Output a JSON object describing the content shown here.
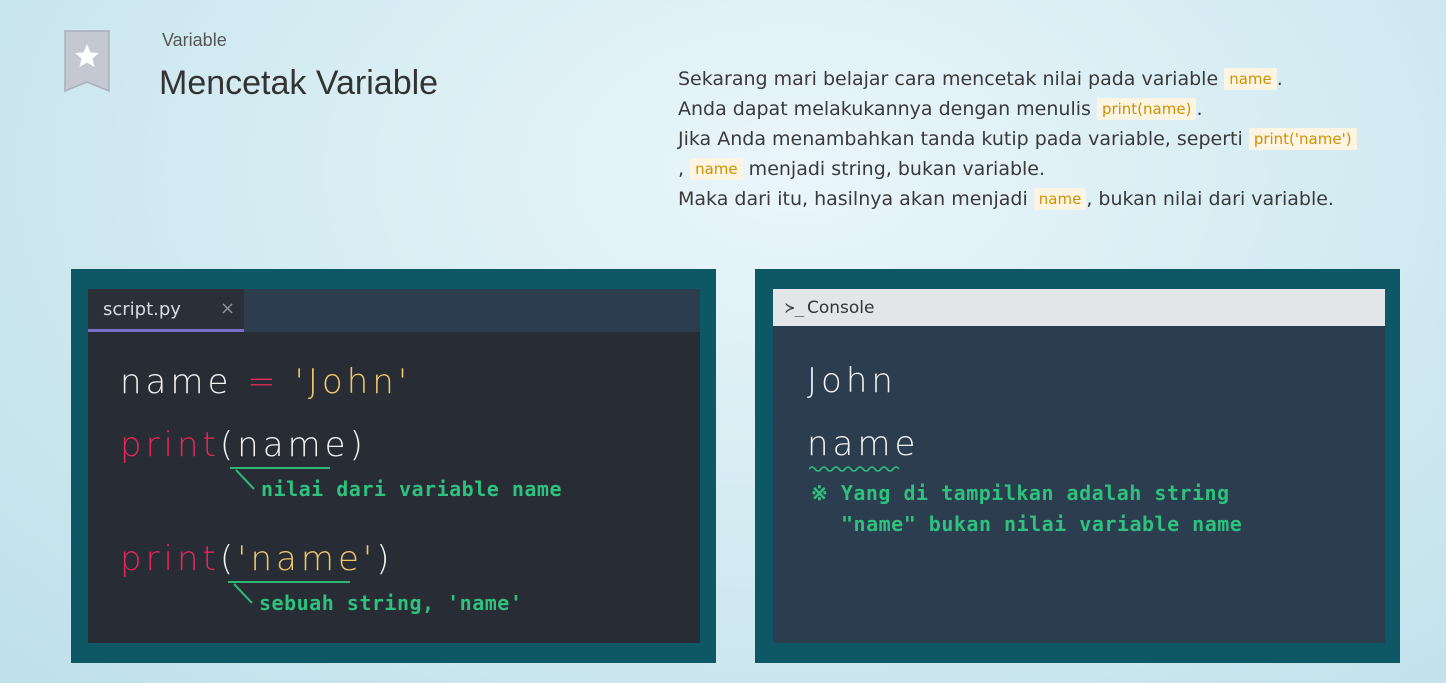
{
  "header": {
    "category": "Variable",
    "title": "Mencetak Variable"
  },
  "description": {
    "line1_text": "Sekarang mari belajar cara mencetak nilai pada variable ",
    "line1_code": "name",
    "line1_end": ".",
    "line2_text": "Anda dapat melakukannya dengan menulis ",
    "line2_code": "print(name)",
    "line2_end": ".",
    "line3_text": "Jika Anda menambahkan tanda kutip pada variable, seperti ",
    "line3_code": "print('name')",
    "line4_start": ",",
    "line4_code": "name",
    "line4_text": " menjadi string, bukan variable.",
    "line5_text": "Maka dari itu, hasilnya akan menjadi ",
    "line5_code": "name",
    "line5_end": ", bukan nilai dari variable."
  },
  "editor": {
    "tab_name": "script.py",
    "tab_close": "×",
    "line1": {
      "var": "name",
      "op": "=",
      "str": "'John'"
    },
    "line2": {
      "func": "print",
      "open": "(",
      "arg": "name",
      "close": ")"
    },
    "line3": {
      "func": "print",
      "open": "(",
      "arg": "'name'",
      "close": ")"
    },
    "annotation1": "nilai dari variable name",
    "annotation2": "sebuah string, 'name'"
  },
  "console": {
    "icon": "≻_",
    "title": "Console",
    "output1": "John",
    "output2": "name",
    "note_mark": "※",
    "note_line1": "Yang di tampilkan adalah string",
    "note_line2": "\"name\" bukan nilai variable name"
  },
  "colors": {
    "panel": "#0e5866",
    "editor_bg": "#282c34",
    "keyword": "#e6285a",
    "string": "#f1c76c",
    "annotation": "#2ec27e",
    "inline_code": "#d19000"
  }
}
